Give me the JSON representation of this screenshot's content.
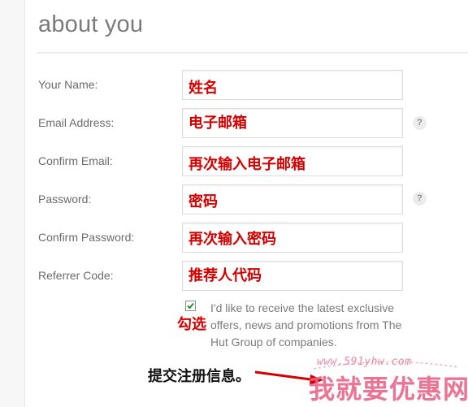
{
  "header": {
    "title": "about you"
  },
  "form": {
    "fields": [
      {
        "label": "Your Name:",
        "value": "",
        "overlay": "姓名",
        "help": ""
      },
      {
        "label": "Email Address:",
        "value": "",
        "overlay": "电子邮箱",
        "help": "?"
      },
      {
        "label": "Confirm Email:",
        "value": "",
        "overlay": "再次输入电子邮箱",
        "help": ""
      },
      {
        "label": "Password:",
        "value": "",
        "overlay": "密码",
        "help": "?"
      },
      {
        "label": "Confirm Password:",
        "value": "",
        "overlay": "再次输入密码",
        "help": ""
      },
      {
        "label": "Referrer Code:",
        "value": "",
        "overlay": "推荐人代码",
        "help": ""
      }
    ],
    "consent": {
      "checked": true,
      "text": "I'd like to receive the latest exclusive offers, news and promotions from The Hut Group of companies.",
      "overlay": "勾选"
    }
  },
  "annotations": {
    "submit_note": "提交注册信息。"
  },
  "watermark": {
    "url": "www.591yhw.com",
    "text": "我就要优惠网"
  },
  "colors": {
    "annotation_red": "#d40000",
    "watermark_pink": "#e9658a",
    "check_green": "#2e8b2e"
  }
}
